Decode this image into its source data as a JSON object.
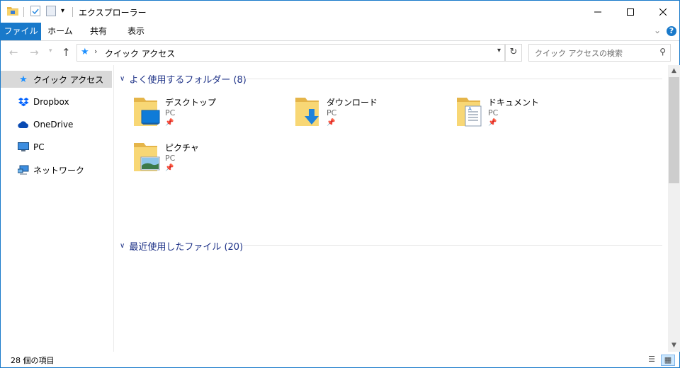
{
  "window": {
    "title": "エクスプローラー"
  },
  "ribbon": {
    "tabs": [
      "ファイル",
      "ホーム",
      "共有",
      "表示"
    ],
    "help": "?"
  },
  "addressbar": {
    "path": "クイック アクセス",
    "search_placeholder": "クイック アクセスの検索"
  },
  "navpane": {
    "items": [
      {
        "label": "クイック アクセス",
        "icon": "star-icon",
        "selected": true
      },
      {
        "label": "Dropbox",
        "icon": "dropbox-icon"
      },
      {
        "label": "OneDrive",
        "icon": "onedrive-icon"
      },
      {
        "label": "PC",
        "icon": "pc-icon"
      },
      {
        "label": "ネットワーク",
        "icon": "network-icon"
      }
    ]
  },
  "content": {
    "frequent": {
      "header": "よく使用するフォルダー (8)",
      "folders": [
        {
          "name": "デスクトップ",
          "location": "PC",
          "icon": "desktop-folder-icon"
        },
        {
          "name": "ダウンロード",
          "location": "PC",
          "icon": "downloads-folder-icon"
        },
        {
          "name": "ドキュメント",
          "location": "PC",
          "icon": "documents-folder-icon"
        },
        {
          "name": "ピクチャ",
          "location": "PC",
          "icon": "pictures-folder-icon"
        }
      ]
    },
    "recent": {
      "header": "最近使用したファイル (20)"
    }
  },
  "status": {
    "count": "28 個の項目"
  },
  "colors": {
    "accent": "#1979ca",
    "group_header": "#1e3287",
    "selected": "#d9d9d9"
  }
}
